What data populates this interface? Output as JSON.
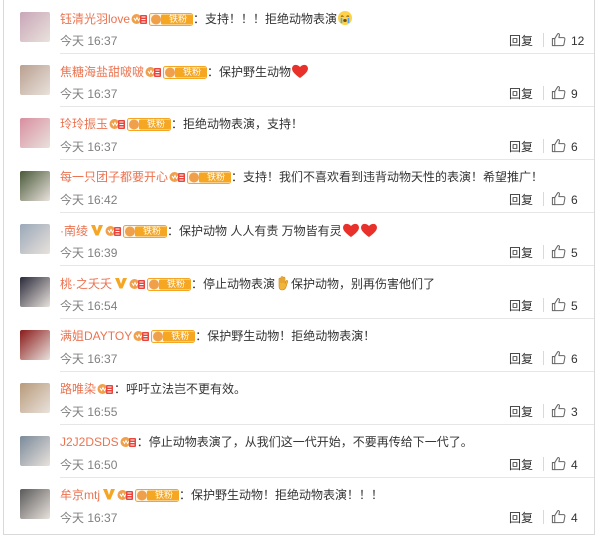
{
  "colors": {
    "username": "#eb7350",
    "text": "#333333",
    "time": "#808080",
    "divider": "#e6e6e6"
  },
  "comments": [
    {
      "user": "钰清光羽love",
      "badges": [
        "crown",
        "tie"
      ],
      "text": "支持！！！拒绝动物表演",
      "emoji": "cry",
      "time": "今天 16:37",
      "reply": "回复",
      "likes": "12",
      "avatar_color": "#c9a6b8"
    },
    {
      "user": "焦糖海盐甜啵啵",
      "badges": [
        "crown",
        "tie"
      ],
      "text": "保护野生动物",
      "emoji": "heart",
      "time": "今天 16:37",
      "reply": "回复",
      "likes": "9",
      "avatar_color": "#b9a090"
    },
    {
      "user": "玲玲振玉",
      "badges": [
        "crown",
        "tie"
      ],
      "text": "拒绝动物表演，支持！",
      "emoji": "",
      "time": "今天 16:37",
      "reply": "回复",
      "likes": "6",
      "avatar_color": "#d98ea0"
    },
    {
      "user": "每一只团子都要开心",
      "badges": [
        "crown",
        "tie"
      ],
      "text": "支持！我们不喜欢看到违背动物天性的表演！希望推广！",
      "emoji": "",
      "time": "今天 16:42",
      "reply": "回复",
      "likes": "6",
      "avatar_color": "#4a5a3a"
    },
    {
      "user": "·南绫",
      "badges": [
        "v",
        "crown",
        "tie"
      ],
      "text": "保护动物 人人有责 万物皆有灵",
      "emoji": "hearts2",
      "time": "今天 16:39",
      "reply": "回复",
      "likes": "5",
      "avatar_color": "#9aa8b8"
    },
    {
      "user": "桃·之夭夭",
      "badges": [
        "v",
        "crown",
        "tie"
      ],
      "text": "停止动物表演",
      "emoji": "hand",
      "text2": "保护动物，别再伤害他们了",
      "time": "今天 16:54",
      "reply": "回复",
      "likes": "5",
      "avatar_color": "#2a2a3a"
    },
    {
      "user": "满姐DAYTOY",
      "badges": [
        "crown",
        "tie"
      ],
      "text": "保护野生动物！拒绝动物表演！",
      "emoji": "",
      "time": "今天 16:37",
      "reply": "回复",
      "likes": "6",
      "avatar_color": "#8a1a1a"
    },
    {
      "user": "路唯染",
      "badges": [
        "crown"
      ],
      "text": "呼吁立法岂不更有效。",
      "emoji": "",
      "time": "今天 16:55",
      "reply": "回复",
      "likes": "3",
      "avatar_color": "#b89a7a"
    },
    {
      "user": "J2J2DSDS",
      "badges": [
        "crown"
      ],
      "text": "停止动物表演了，从我们这一代开始，不要再传给下一代了。",
      "emoji": "",
      "time": "今天 16:50",
      "reply": "回复",
      "likes": "4",
      "avatar_color": "#7a8a9a"
    },
    {
      "user": "牟京mtj",
      "badges": [
        "v",
        "crown",
        "tie"
      ],
      "text": "保护野生动物！拒绝动物表演！！！",
      "emoji": "",
      "time": "今天 16:37",
      "reply": "回复",
      "likes": "4",
      "avatar_color": "#5a5a5a"
    }
  ],
  "badge_tie_label": "铁粉"
}
